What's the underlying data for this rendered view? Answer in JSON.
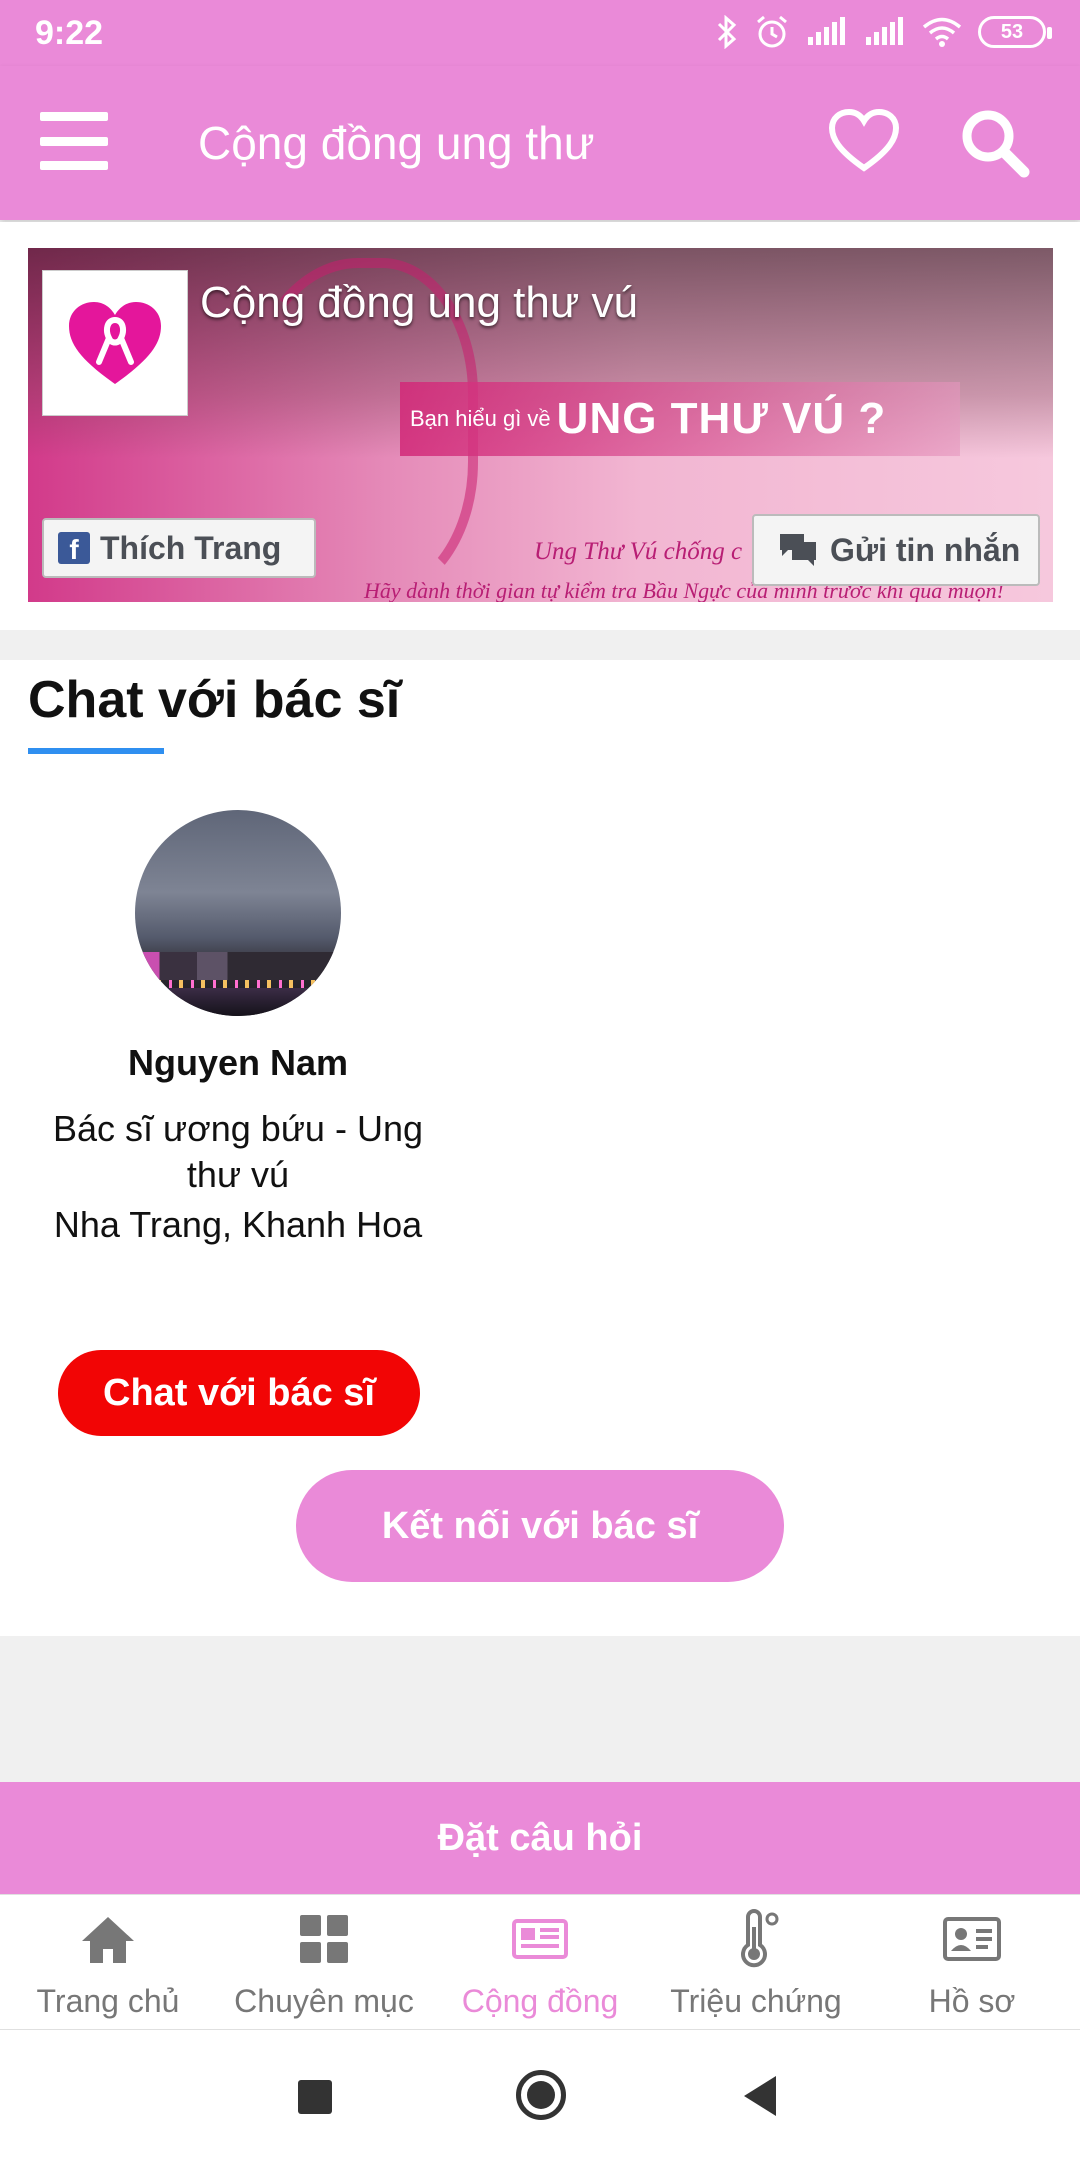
{
  "status_bar": {
    "time": "9:22",
    "battery": "53"
  },
  "app_bar": {
    "title": "Cộng đồng ung thư",
    "icons": [
      "menu-icon",
      "heart-icon",
      "search-icon"
    ]
  },
  "banner": {
    "title": "Cộng đồng ung thư vú",
    "ribbon_small": "Bạn hiểu gì về",
    "ribbon_big": "UNG THƯ VÚ ?",
    "tagline_1": "Ung Thư Vú chống c",
    "tagline_2": "Hãy dành thời gian tự kiểm tra Bầu Ngực của mình trước khi quá muộn!",
    "like_button": "Thích Trang",
    "message_button": "Gửi tin nhắn"
  },
  "chat_section": {
    "title": "Chat với bác sĩ",
    "doctor": {
      "name": "Nguyen Nam",
      "specialty": "Bác sĩ ương bứu - Ung thư vú",
      "location": "Nha Trang, Khanh Hoa"
    },
    "chat_button": "Chat với bác sĩ",
    "connect_button": "Kết nối với bác sĩ"
  },
  "ask_bar": {
    "label": "Đặt câu hỏi"
  },
  "bottom_nav": {
    "items": [
      {
        "label": "Trang chủ",
        "icon": "home-icon"
      },
      {
        "label": "Chuyên mục",
        "icon": "grid-icon"
      },
      {
        "label": "Cộng đồng",
        "icon": "newspaper-icon",
        "active": true
      },
      {
        "label": "Triệu chứng",
        "icon": "thermometer-icon"
      },
      {
        "label": "Hồ sơ",
        "icon": "profile-card-icon"
      }
    ]
  },
  "colors": {
    "brand_pink": "#ea8ad8",
    "chat_red": "#f20505",
    "underline_blue": "#2f8ff0"
  }
}
